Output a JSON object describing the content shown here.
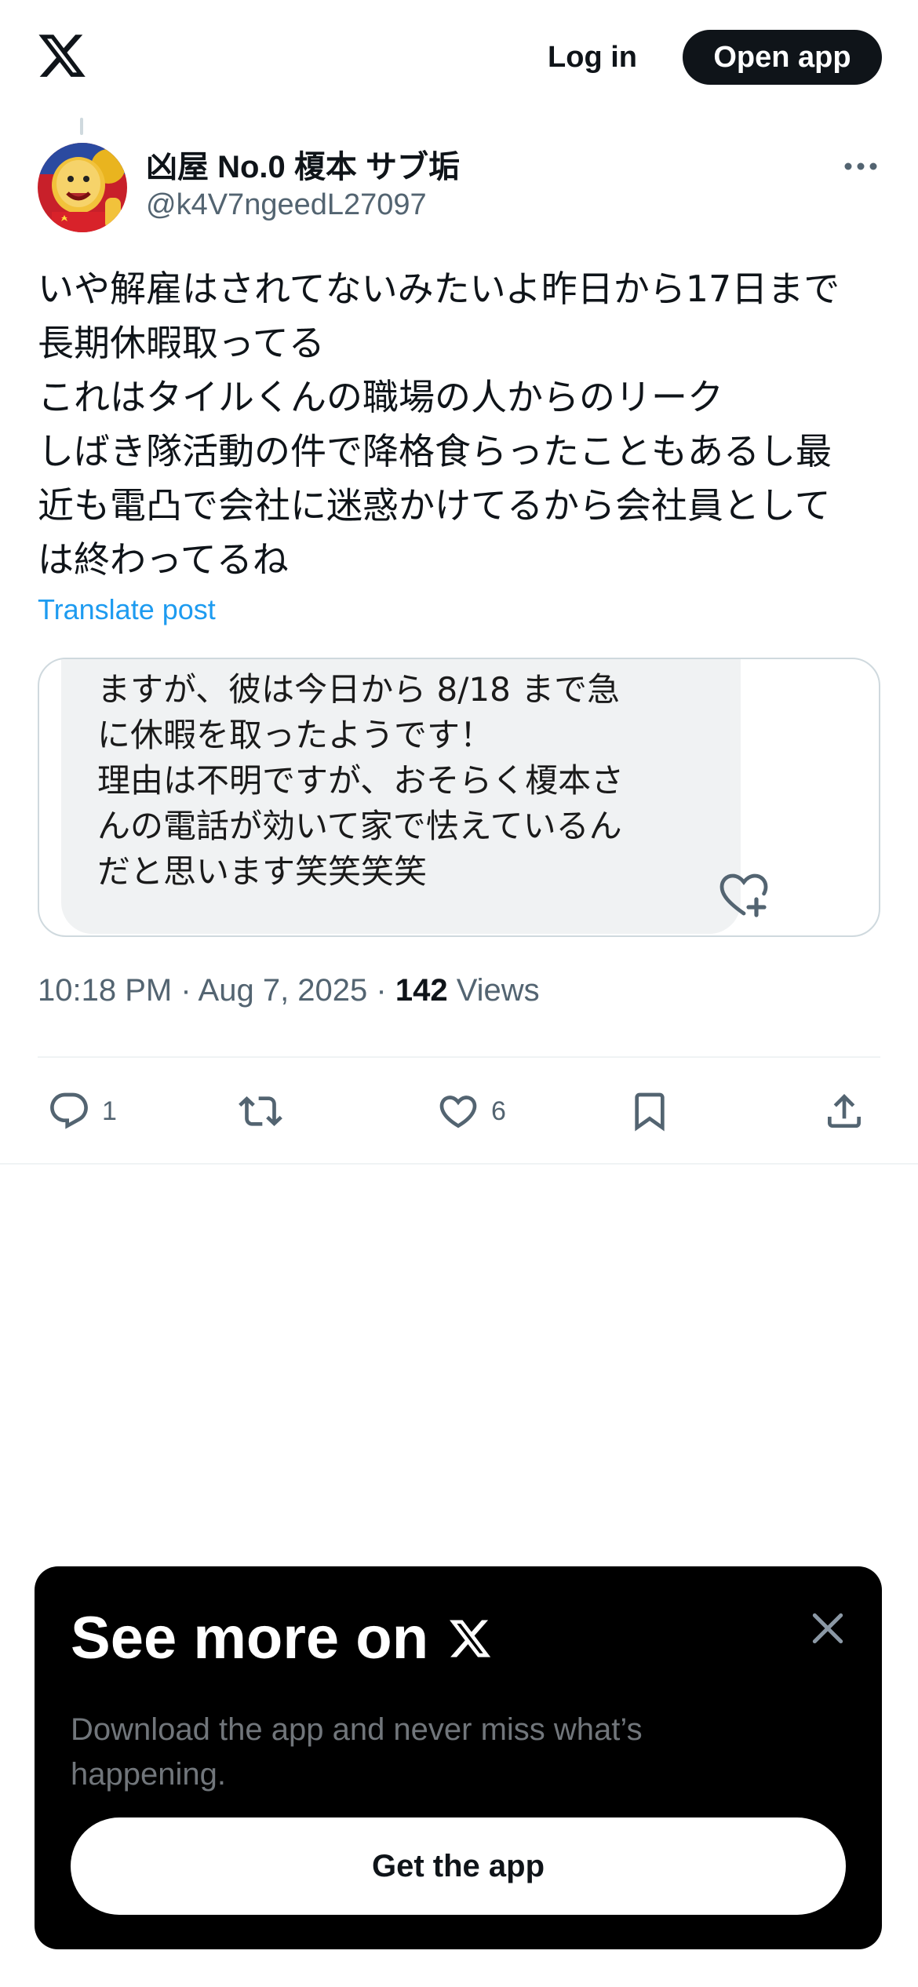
{
  "header": {
    "login_label": "Log in",
    "open_app_label": "Open app"
  },
  "post": {
    "author_name": "凶屋 No.0 榎本 サブ垢",
    "author_handle": "@k4V7ngeedL27097",
    "text_lines": [
      "いや解雇はされてないみたいよ昨日から17日まで",
      "長期休暇取ってる",
      "これはタイルくんの職場の人からのリーク",
      "しばき隊活動の件で降格食らったこともあるし最",
      "近も電凸で会社に迷惑かけてるから会社員として",
      "は終わってるね"
    ],
    "translate_label": "Translate post",
    "media_text_lines": [
      "ますが、彼は今日から 8/18 まで急",
      "に休暇を取ったようです！",
      "理由は不明ですが、おそらく榎本さ",
      "んの電話が効いて家で怯えているん",
      "だと思います笑笑笑笑"
    ],
    "timestamp": "10:18 PM · Aug 7, 2025 · ",
    "views_count": "142",
    "views_label": " Views",
    "actions": {
      "replies": "1",
      "likes": "6"
    }
  },
  "promo": {
    "title": "See more on",
    "description": "Download the app and never miss what’s happening.",
    "button_label": "Get the app"
  },
  "colors": {
    "text_primary": "#0f1419",
    "text_secondary": "#536471",
    "link": "#1d9bf0",
    "promo_bg": "#000000"
  }
}
